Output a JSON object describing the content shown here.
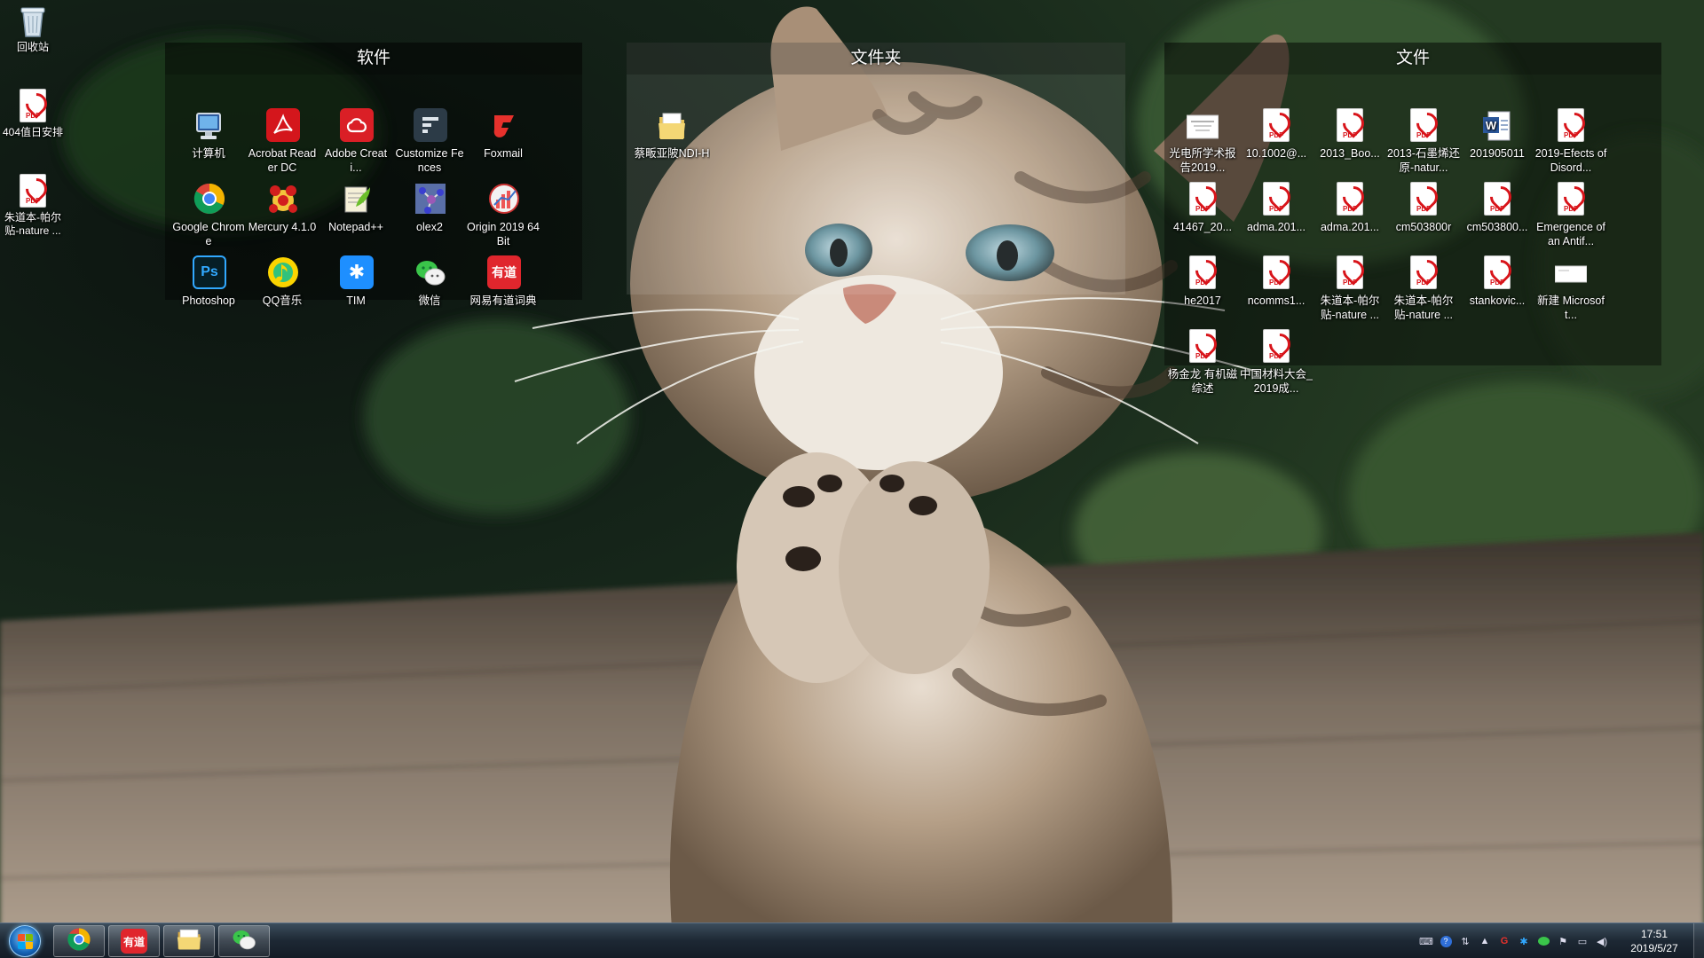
{
  "desktop_icons": [
    {
      "label": "回收站",
      "icon": "recycle-bin-icon"
    },
    {
      "label": "404值日安排",
      "icon": "pdf-file-icon"
    },
    {
      "label": "朱道本-帕尔贴-nature ...",
      "icon": "pdf-file-icon"
    }
  ],
  "fences": {
    "software": {
      "title": "软件",
      "items": [
        {
          "label": "计算机",
          "icon": "computer-icon"
        },
        {
          "label": "Acrobat Reader DC",
          "icon": "acrobat-icon"
        },
        {
          "label": "Adobe Creati...",
          "icon": "adobe-cc-icon"
        },
        {
          "label": "Customize Fences",
          "icon": "fences-icon"
        },
        {
          "label": "Foxmail",
          "icon": "foxmail-icon"
        },
        {
          "label": "Google Chrome",
          "icon": "chrome-icon"
        },
        {
          "label": "Mercury 4.1.0",
          "icon": "mercury-icon"
        },
        {
          "label": "Notepad++",
          "icon": "notepadpp-icon"
        },
        {
          "label": "olex2",
          "icon": "olex2-icon"
        },
        {
          "label": "Origin 2019 64Bit",
          "icon": "origin-icon"
        },
        {
          "label": "Photoshop",
          "icon": "photoshop-icon"
        },
        {
          "label": "QQ音乐",
          "icon": "qq-music-icon"
        },
        {
          "label": "TIM",
          "icon": "tim-icon"
        },
        {
          "label": "微信",
          "icon": "wechat-icon"
        },
        {
          "label": "网易有道词典",
          "icon": "youdao-icon"
        }
      ]
    },
    "folders": {
      "title": "文件夹",
      "items": [
        {
          "label": "蔡畈亚陂NDI-H",
          "icon": "folder-icon"
        }
      ]
    },
    "files": {
      "title": "文件",
      "items": [
        {
          "label": "光电所学术报告2019...",
          "icon": "document-thumb-icon"
        },
        {
          "label": "10.1002@...",
          "icon": "pdf-file-icon"
        },
        {
          "label": "2013_Boo...",
          "icon": "pdf-file-icon"
        },
        {
          "label": "2013-石墨烯还原-natur...",
          "icon": "pdf-file-icon"
        },
        {
          "label": "201905011",
          "icon": "word-file-icon"
        },
        {
          "label": "2019-Efects of Disord...",
          "icon": "pdf-file-icon"
        },
        {
          "label": "41467_20...",
          "icon": "pdf-file-icon"
        },
        {
          "label": "adma.201...",
          "icon": "pdf-file-icon"
        },
        {
          "label": "adma.201...",
          "icon": "pdf-file-icon"
        },
        {
          "label": "cm503800r",
          "icon": "pdf-file-icon"
        },
        {
          "label": "cm503800...",
          "icon": "pdf-file-icon"
        },
        {
          "label": "Emergence of an Antif...",
          "icon": "pdf-file-icon"
        },
        {
          "label": "he2017",
          "icon": "pdf-file-icon"
        },
        {
          "label": "ncomms1...",
          "icon": "pdf-file-icon"
        },
        {
          "label": "朱道本-帕尔贴-nature ...",
          "icon": "pdf-file-icon"
        },
        {
          "label": "朱道本-帕尔贴-nature ...",
          "icon": "pdf-file-icon"
        },
        {
          "label": "stankovic...",
          "icon": "pdf-file-icon"
        },
        {
          "label": "新建 Microsoft...",
          "icon": "blank-document-icon"
        },
        {
          "label": "杨金龙 有机磁综述",
          "icon": "pdf-file-icon"
        },
        {
          "label": "中国材料大会_2019成...",
          "icon": "pdf-file-icon"
        }
      ]
    }
  },
  "pdf_badge": "PDF",
  "taskbar": {
    "pinned": [
      {
        "name": "chrome",
        "icon": "chrome-icon"
      },
      {
        "name": "youdao",
        "icon": "youdao-icon",
        "text": "有道"
      },
      {
        "name": "explorer",
        "icon": "folder-icon"
      },
      {
        "name": "wechat",
        "icon": "wechat-icon"
      }
    ],
    "tray_icons": [
      "keyboard-icon",
      "help-icon",
      "network-status-icon",
      "show-hidden-icon",
      "foxmail-tray-icon",
      "tim-tray-icon",
      "wechat-tray-icon",
      "flag-icon",
      "network-icon",
      "volume-icon"
    ],
    "time": "17:51",
    "date": "2019/5/27"
  },
  "colors": {
    "pdf_red": "#d8141a",
    "fence_bg": "rgba(0,0,0,0.38)",
    "taskbar_bg": "#1d2834"
  }
}
